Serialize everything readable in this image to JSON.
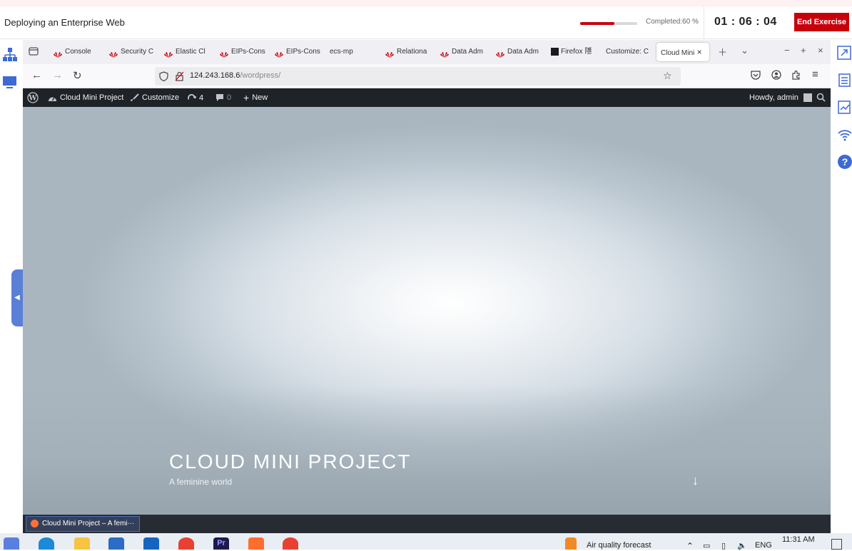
{
  "exercise": {
    "title": "Deploying an Enterprise Web",
    "progress_percent": 60,
    "progress_label": "Completed:60 %",
    "timer": "01 : 06 : 04",
    "end_button": "End Exercise",
    "accent_color": "#c7000b"
  },
  "browser": {
    "tabs": [
      {
        "label": "Console",
        "icon": "huawei-icon"
      },
      {
        "label": "Security C",
        "icon": "huawei-icon"
      },
      {
        "label": "Elastic Cl",
        "icon": "huawei-icon"
      },
      {
        "label": "EIPs-Cons",
        "icon": "huawei-icon"
      },
      {
        "label": "EIPs-Cons",
        "icon": "huawei-icon"
      },
      {
        "label": "ecs-mp",
        "icon": ""
      },
      {
        "label": "Relationa",
        "icon": "huawei-icon"
      },
      {
        "label": "Data Adm",
        "icon": "huawei-icon"
      },
      {
        "label": "Data Adm",
        "icon": "huawei-icon"
      },
      {
        "label": "Firefox 隱",
        "icon": "terminal-icon"
      },
      {
        "label": "Customize: C",
        "icon": ""
      },
      {
        "label": "Cloud Mini",
        "icon": "",
        "active": true
      }
    ],
    "url_host": "124.243.168.6",
    "url_path": "/wordpress/"
  },
  "wp_admin_bar": {
    "site_name": "Cloud Mini Project",
    "customize": "Customize",
    "updates_count": "4",
    "comments_count": "0",
    "new_label": "New",
    "howdy": "Howdy, admin"
  },
  "hero": {
    "site_title": "CLOUD MINI PROJECT",
    "tagline": "A feminine world"
  },
  "inner_taskbar": {
    "window_label": "Cloud Mini Project – A femi···"
  },
  "windows_taskbar": {
    "weather": "Air quality forecast",
    "language": "ENG",
    "time": "11:31 AM"
  }
}
